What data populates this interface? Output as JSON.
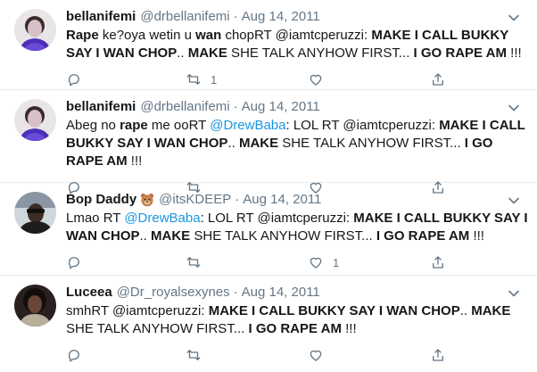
{
  "tweets": [
    {
      "name": "bellanifemi",
      "handle": "@drbellanifemi",
      "dot": "·",
      "date": "Aug 14, 2011",
      "segments": [
        {
          "t": "Rape",
          "s": "b"
        },
        {
          "t": " ke?oya wetin u ",
          "s": ""
        },
        {
          "t": "wan",
          "s": "b"
        },
        {
          "t": " chopRT @iamtcperuzzi: ",
          "s": ""
        },
        {
          "t": "MAKE I CALL BUKKY SAY I WAN CHOP",
          "s": "b"
        },
        {
          "t": ".. ",
          "s": ""
        },
        {
          "t": "MAKE",
          "s": "b"
        },
        {
          "t": " SHE TALK ANYHOW FIRST... ",
          "s": ""
        },
        {
          "t": "I GO RAPE AM",
          "s": "b"
        },
        {
          "t": " !!!",
          "s": ""
        }
      ],
      "reply_count": "",
      "retweet_count": "1",
      "like_count": ""
    },
    {
      "name": "bellanifemi",
      "handle": "@drbellanifemi",
      "dot": "·",
      "date": "Aug 14, 2011",
      "segments": [
        {
          "t": "Abeg no ",
          "s": ""
        },
        {
          "t": "rape",
          "s": "b"
        },
        {
          "t": " me ooRT ",
          "s": ""
        },
        {
          "t": "@DrewBaba",
          "s": "m"
        },
        {
          "t": ": LOL RT @iamtcperuzzi: ",
          "s": ""
        },
        {
          "t": "MAKE I CALL BUKKY SAY I WAN CHOP",
          "s": "b"
        },
        {
          "t": ".. ",
          "s": ""
        },
        {
          "t": "MAKE",
          "s": "b"
        },
        {
          "t": " SHE TALK ANYHOW FIRST... ",
          "s": ""
        },
        {
          "t": "I GO RAPE AM",
          "s": "b"
        },
        {
          "t": " !!!",
          "s": ""
        }
      ],
      "reply_count": "",
      "retweet_count": "",
      "like_count": ""
    },
    {
      "name": "Bop Daddy",
      "emoji": "bear-face-emoji",
      "handle": "@itsKDEEP",
      "dot": "·",
      "date": "Aug 14, 2011",
      "segments": [
        {
          "t": "Lmao RT ",
          "s": ""
        },
        {
          "t": "@DrewBaba",
          "s": "m"
        },
        {
          "t": ": LOL RT @iamtcperuzzi: ",
          "s": ""
        },
        {
          "t": "MAKE I CALL BUKKY SAY I WAN CHOP",
          "s": "b"
        },
        {
          "t": ".. ",
          "s": ""
        },
        {
          "t": "MAKE",
          "s": "b"
        },
        {
          "t": " SHE TALK ANYHOW FIRST... ",
          "s": ""
        },
        {
          "t": "I GO RAPE AM",
          "s": "b"
        },
        {
          "t": " !!!",
          "s": ""
        }
      ],
      "reply_count": "",
      "retweet_count": "",
      "like_count": "1"
    },
    {
      "name": "Luceea",
      "handle": "@Dr_royalsexynes",
      "dot": "·",
      "date": "Aug 14, 2011",
      "segments": [
        {
          "t": "smhRT @iamtcperuzzi: ",
          "s": ""
        },
        {
          "t": "MAKE I CALL BUKKY SAY I WAN CHOP",
          "s": "b"
        },
        {
          "t": ".. ",
          "s": ""
        },
        {
          "t": "MAKE",
          "s": "b"
        },
        {
          "t": " SHE TALK ANYHOW FIRST... ",
          "s": ""
        },
        {
          "t": "I GO RAPE AM",
          "s": "b"
        },
        {
          "t": " !!!",
          "s": ""
        }
      ],
      "reply_count": "",
      "retweet_count": "",
      "like_count": ""
    }
  ],
  "icons": {
    "reply": "reply-icon",
    "retweet": "retweet-icon",
    "like": "like-icon",
    "share": "share-icon",
    "caret": "chevron-down-icon"
  },
  "colors": {
    "text": "#14171a",
    "muted": "#657786",
    "link": "#1b95e0",
    "divider": "#e6ecf0"
  }
}
